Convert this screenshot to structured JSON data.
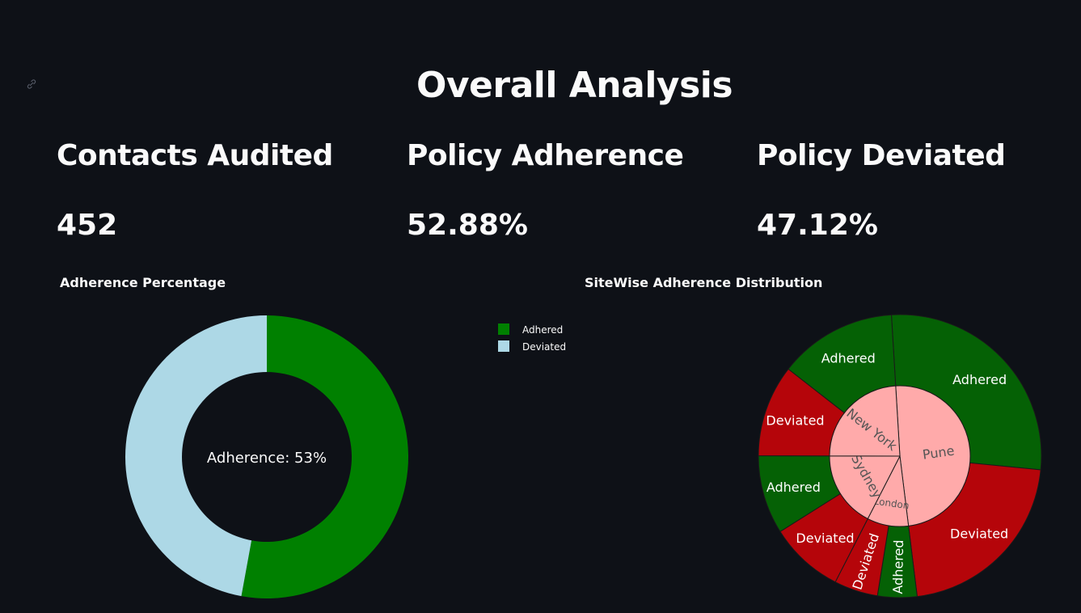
{
  "page": {
    "title": "Overall Analysis"
  },
  "metrics": [
    {
      "label": "Contacts Audited",
      "value": "452"
    },
    {
      "label": "Policy Adherence",
      "value": "52.88%"
    },
    {
      "label": "Policy Deviated",
      "value": "47.12%"
    }
  ],
  "colors": {
    "background": "#0e1117",
    "adhered_donut": "#008000",
    "deviated_donut": "#add8e6",
    "adhered_sun": "#056105",
    "deviated_sun": "#b5050a",
    "site_inner": "#ffaaaa"
  },
  "icons": {
    "anchor": "link-icon"
  },
  "chart_data": [
    {
      "type": "pie",
      "title": "Adherence Percentage",
      "center_label": "Adherence: 53%",
      "categories": [
        "Adhered",
        "Deviated"
      ],
      "values": [
        52.88,
        47.12
      ],
      "legend_position": "top-right"
    },
    {
      "type": "sunburst",
      "title": "SiteWise Adherence Distribution",
      "sites": [
        {
          "name": "Pune",
          "value": 49.0,
          "children": [
            {
              "name": "Adhered",
              "value": 27.5
            },
            {
              "name": "Deviated",
              "value": 21.5
            }
          ]
        },
        {
          "name": "London",
          "value": 9.5,
          "children": [
            {
              "name": "Adhered",
              "value": 4.5
            },
            {
              "name": "Deviated",
              "value": 5.0
            }
          ]
        },
        {
          "name": "Sydney",
          "value": 17.5,
          "children": [
            {
              "name": "Deviated",
              "value": 8.5
            },
            {
              "name": "Adhered",
              "value": 9.0
            }
          ]
        },
        {
          "name": "New York",
          "value": 24.0,
          "children": [
            {
              "name": "Deviated",
              "value": 10.5
            },
            {
              "name": "Adhered",
              "value": 13.5
            }
          ]
        }
      ]
    }
  ]
}
